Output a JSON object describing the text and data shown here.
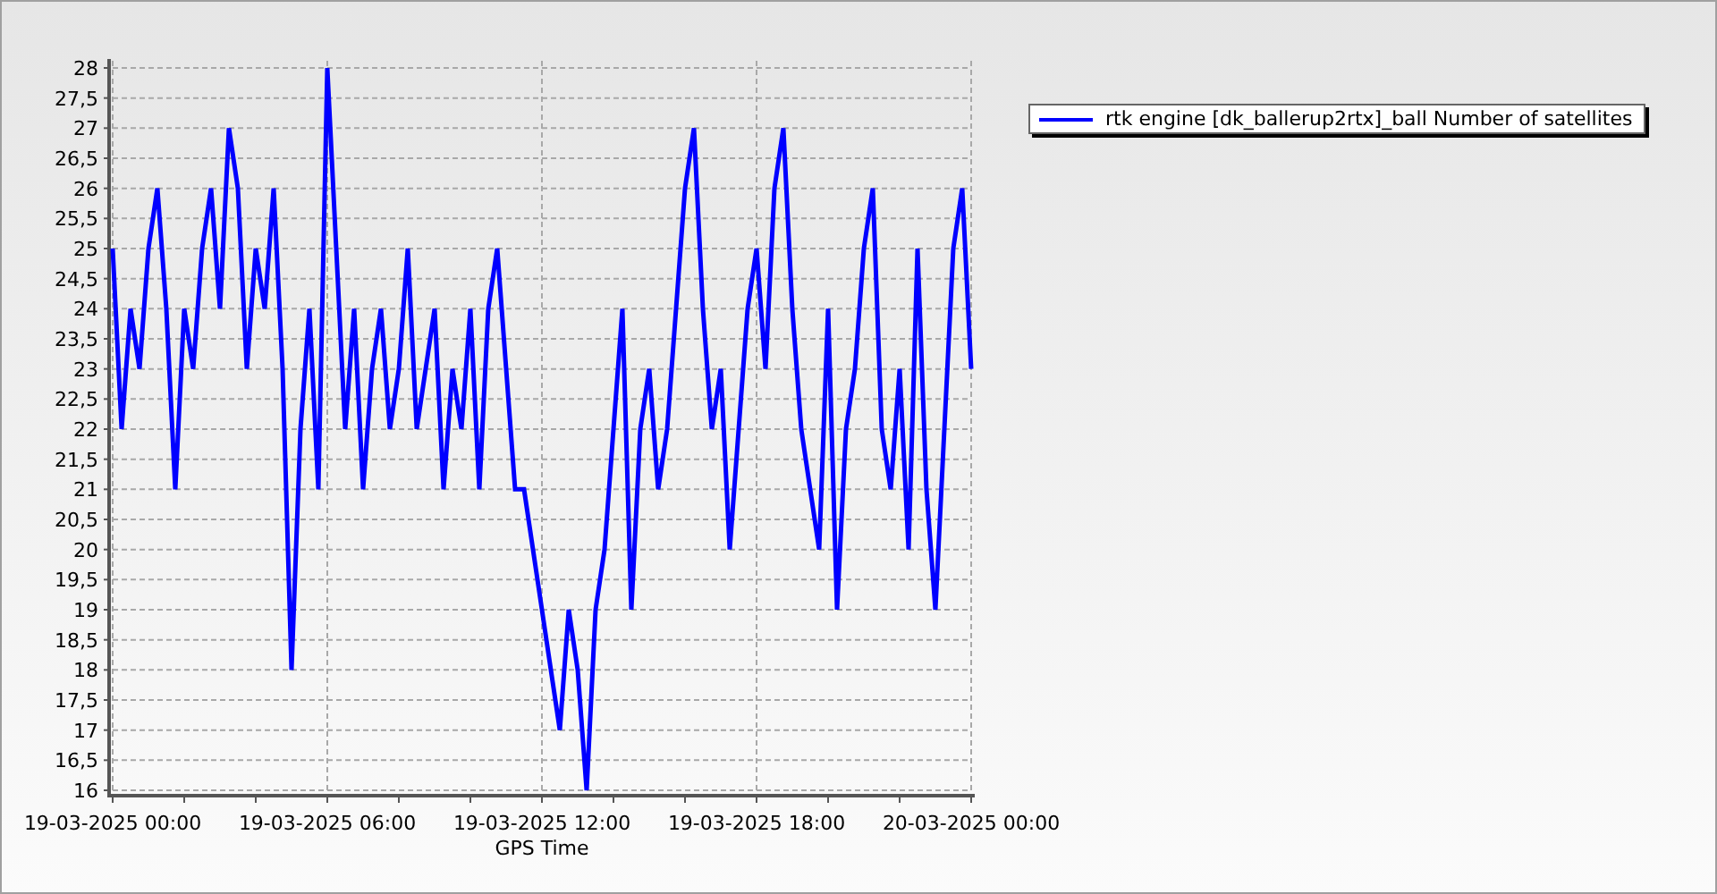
{
  "chart": {
    "chart_data": {
      "type": "line",
      "grid": true,
      "xlabel": "GPS Time",
      "ylim": [
        16,
        28
      ],
      "categories": [
        "19-03-2025 00:00",
        null,
        null,
        null,
        null,
        null,
        null,
        null,
        null,
        null,
        null,
        null,
        null,
        null,
        null,
        null,
        null,
        null,
        null,
        null,
        null,
        null,
        null,
        null,
        "19-03-2025 06:00",
        null,
        null,
        null,
        null,
        null,
        null,
        null,
        null,
        null,
        null,
        null,
        null,
        null,
        null,
        null,
        null,
        null,
        null,
        null,
        null,
        null,
        null,
        null,
        "19-03-2025 12:00",
        null,
        null,
        null,
        null,
        null,
        null,
        null,
        null,
        null,
        null,
        null,
        null,
        null,
        null,
        null,
        null,
        null,
        null,
        null,
        null,
        null,
        null,
        null,
        "19-03-2025 18:00",
        null,
        null,
        null,
        null,
        null,
        null,
        null,
        null,
        null,
        null,
        null,
        null,
        null,
        null,
        null,
        null,
        null,
        null,
        null,
        null,
        null,
        null,
        null,
        "20-03-2025 00:00"
      ],
      "yticks": [
        16,
        {
          "value": 16.5,
          "label": "16,5"
        },
        17,
        {
          "value": 17.5,
          "label": "17,5"
        },
        18,
        {
          "value": 18.5,
          "label": "18,5"
        },
        19,
        {
          "value": 19.5,
          "label": "19,5"
        },
        20,
        {
          "value": 20.5,
          "label": "20,5"
        },
        21,
        {
          "value": 21.5,
          "label": "21,5"
        },
        22,
        {
          "value": 22.5,
          "label": "22,5"
        },
        23,
        {
          "value": 23.5,
          "label": "23,5"
        },
        24,
        {
          "value": 24.5,
          "label": "24,5"
        },
        25,
        {
          "value": 25.5,
          "label": "25,5"
        },
        26,
        {
          "value": 26.5,
          "label": "26,5"
        },
        27,
        {
          "value": 27.5,
          "label": "27,5"
        },
        28
      ],
      "series": [
        {
          "name": "rtk engine [dk_ballerup2rtx]_ball Number of satellites",
          "color": "#0000ff",
          "values": [
            25,
            22,
            24,
            23,
            25,
            26,
            24,
            21,
            24,
            23,
            25,
            26,
            24,
            27,
            26,
            23,
            25,
            24,
            26,
            23,
            18,
            22,
            24,
            21,
            28,
            25,
            22,
            24,
            21,
            23,
            24,
            22,
            23,
            25,
            22,
            23,
            24,
            21,
            23,
            22,
            24,
            21,
            24,
            25,
            23,
            21,
            21,
            20,
            19,
            18,
            17,
            19,
            18,
            16,
            19,
            20,
            22,
            24,
            19,
            22,
            23,
            21,
            22,
            24,
            26,
            27,
            24,
            22,
            23,
            20,
            22,
            24,
            25,
            23,
            26,
            27,
            24,
            22,
            21,
            20,
            24,
            19,
            22,
            23,
            25,
            26,
            22,
            21,
            23,
            20,
            25,
            21,
            19,
            22,
            25,
            26,
            23
          ]
        }
      ]
    }
  }
}
